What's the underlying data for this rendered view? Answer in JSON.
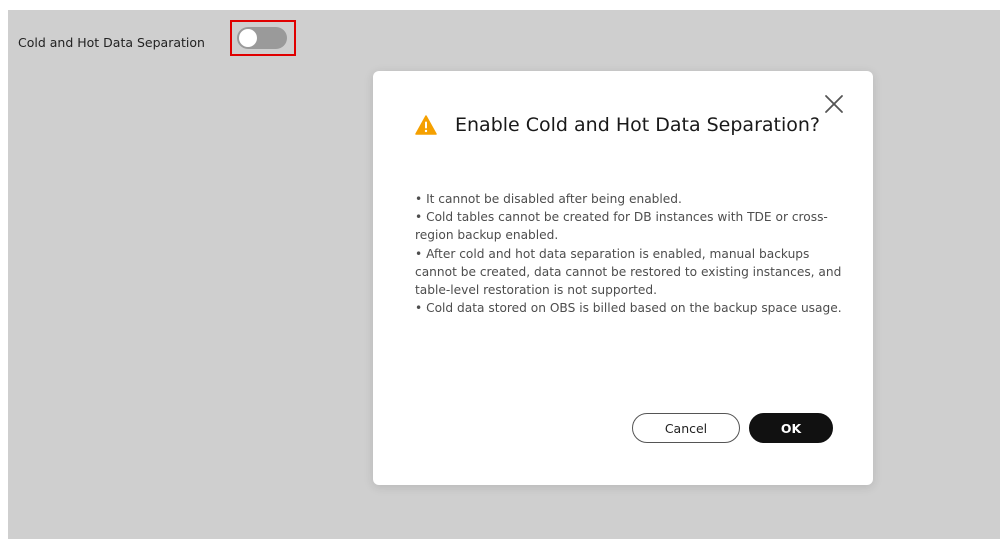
{
  "setting": {
    "label": "Cold and Hot Data Separation",
    "toggle_enabled": false
  },
  "dialog": {
    "title": "Enable Cold and Hot Data Separation?",
    "bullets": [
      "• It cannot be disabled after being enabled.",
      "• Cold tables cannot be created for DB instances with TDE or cross-region backup enabled.",
      "• After cold and hot data separation is enabled, manual backups cannot be created, data cannot be restored to existing instances, and table-level restoration is not supported.",
      "• Cold data stored on OBS is billed based on the backup space usage."
    ],
    "cancel_label": "Cancel",
    "ok_label": "OK"
  },
  "icons": {
    "warning": "warning-triangle-icon",
    "close": "close-icon"
  },
  "colors": {
    "highlight": "#e00000",
    "warning": "#f5a000",
    "toggle_off": "#9a9a9a",
    "primary_button": "#111111",
    "overlay": "#cfcfcf"
  }
}
